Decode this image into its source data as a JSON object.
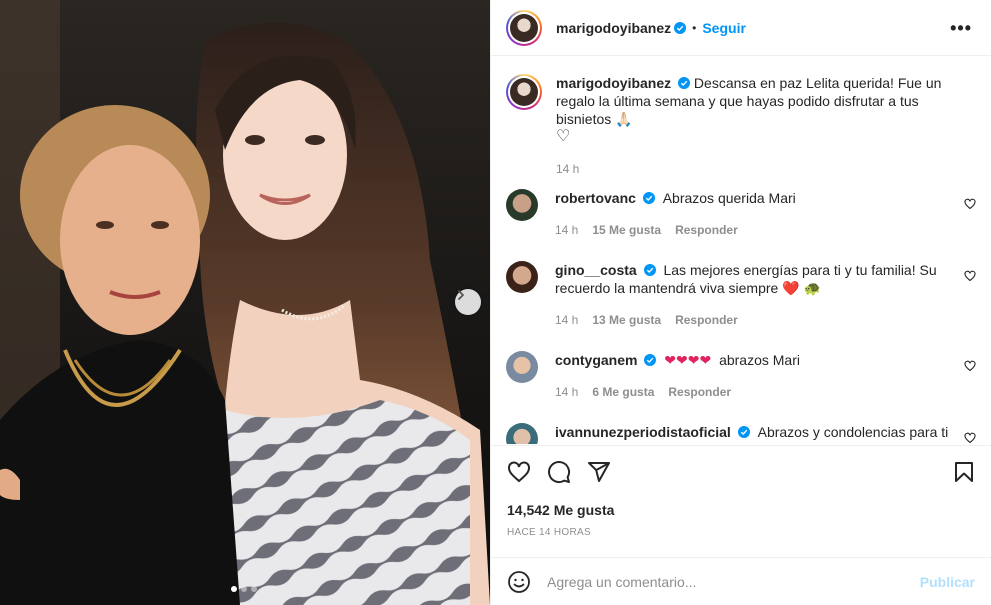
{
  "post": {
    "username": "marigodoyibanez",
    "follow_label": "Seguir",
    "separator": "•",
    "more_label": "•••",
    "caption": "Descansa en paz Lelita querida! Fue un regalo la última semana y que hayas podido disfrutar a tus bisnietos 🙏🏻",
    "caption_heart": "♡",
    "caption_time": "14 h",
    "likes": "14,542 Me gusta",
    "posted_ago": "HACE 14 HORAS",
    "carousel": {
      "current": 1,
      "total": 3
    }
  },
  "comments": [
    {
      "username": "robertovanc",
      "text": "Abrazos querida Mari",
      "time": "14 h",
      "likes": "15 Me gusta",
      "reply": "Responder"
    },
    {
      "username": "gino__costa",
      "text": "Las mejores energías para ti y tu familia! Su recuerdo la mantendrá viva siempre ❤️ 🐢",
      "time": "14 h",
      "likes": "13 Me gusta",
      "reply": "Responder"
    },
    {
      "username": "contyganem",
      "text": "abrazos Mari",
      "hearts": "❤❤❤❤",
      "time": "14 h",
      "likes": "6 Me gusta",
      "reply": "Responder"
    },
    {
      "username": "ivannunezperiodistaoficial",
      "text": "Abrazos y condolencias para ti y",
      "time": "",
      "likes": "",
      "reply": ""
    }
  ],
  "composer": {
    "placeholder": "Agrega un comentario...",
    "post_label": "Publicar"
  },
  "colors": {
    "accent": "#0095f6",
    "text": "#262626",
    "muted": "#8e8e8e",
    "verified": "#0095f6",
    "heart": "#e0245e",
    "publish_disabled": "#b2dffc"
  },
  "icons": [
    "verified-badge-icon",
    "more-options-icon",
    "heart-icon",
    "comment-icon",
    "share-icon",
    "bookmark-icon",
    "emoji-icon",
    "chevron-right-icon"
  ]
}
